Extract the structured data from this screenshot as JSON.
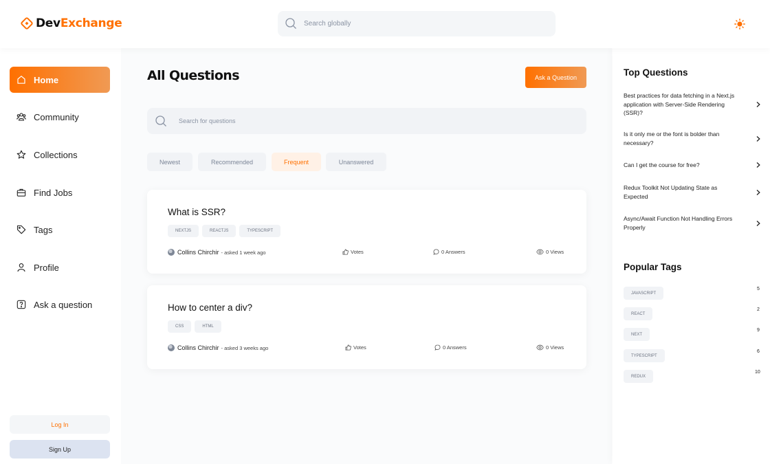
{
  "header": {
    "brand_part1": "Dev",
    "brand_part2": "Exchange",
    "search_placeholder": "Search globally",
    "accent_color": "#ff7000"
  },
  "sidebar": {
    "items": [
      {
        "label": "Home",
        "icon": "home-icon",
        "active": true
      },
      {
        "label": "Community",
        "icon": "users-icon"
      },
      {
        "label": "Collections",
        "icon": "star-icon"
      },
      {
        "label": "Find Jobs",
        "icon": "briefcase-icon"
      },
      {
        "label": "Tags",
        "icon": "tag-icon"
      },
      {
        "label": "Profile",
        "icon": "user-icon"
      },
      {
        "label": "Ask a question",
        "icon": "question-icon"
      }
    ],
    "login_label": "Log In",
    "signup_label": "Sign Up"
  },
  "main": {
    "title": "All Questions",
    "ask_button": "Ask a Question",
    "search_placeholder": "Search for questions",
    "filters": [
      {
        "label": "Newest"
      },
      {
        "label": "Recommended"
      },
      {
        "label": "Frequent",
        "active": true
      },
      {
        "label": "Unanswered"
      }
    ],
    "questions": [
      {
        "title": "What is SSR?",
        "tags": [
          "NEXTJS",
          "REACTJS",
          "TYPESCRIPT"
        ],
        "author": "Collins Chirchir",
        "asked": "- asked 1 week ago",
        "votes": "Votes",
        "answers": "0 Answers",
        "views": "0 Views"
      },
      {
        "title": "How to center a div?",
        "tags": [
          "CSS",
          "HTML"
        ],
        "author": "Collins Chirchir",
        "asked": "- asked 3 weeks ago",
        "votes": "Votes",
        "answers": "0 Answers",
        "views": "0 Views"
      }
    ]
  },
  "rightbar": {
    "top_questions_title": "Top Questions",
    "top_questions": [
      "Best practices for data fetching in a Next.js application with Server-Side Rendering (SSR)?",
      "Is it only me or the font is bolder than necessary?",
      "Can I get the course for free?",
      "Redux Toolkit Not Updating State as Expected",
      "Async/Await Function Not Handling Errors Properly"
    ],
    "popular_tags_title": "Popular Tags",
    "popular_tags": [
      {
        "name": "JAVASCRIPT",
        "count": "5"
      },
      {
        "name": "REACT",
        "count": "2"
      },
      {
        "name": "NEXT",
        "count": "9"
      },
      {
        "name": "TYPESCRIPT",
        "count": "6"
      },
      {
        "name": "REDUX",
        "count": "10"
      }
    ]
  }
}
